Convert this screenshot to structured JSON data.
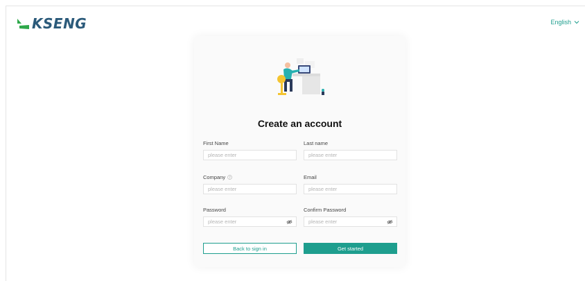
{
  "brand": {
    "name": "KSENG",
    "colors": {
      "primary": "#1e9e8e",
      "logo": "#2b5a7a",
      "logo_mark": "#2ea84a"
    }
  },
  "header": {
    "language": "English"
  },
  "form": {
    "title": "Create an account",
    "fields": {
      "first_name": {
        "label": "First Name",
        "placeholder": "please enter"
      },
      "last_name": {
        "label": "Last name",
        "placeholder": "please enter"
      },
      "company": {
        "label": "Company",
        "placeholder": "please enter"
      },
      "email": {
        "label": "Email",
        "placeholder": "please enter"
      },
      "password": {
        "label": "Password",
        "placeholder": "please enter"
      },
      "confirm_password": {
        "label": "Confirm Password",
        "placeholder": "please enter"
      }
    },
    "buttons": {
      "back": "Back to sign in",
      "submit": "Get started"
    }
  }
}
